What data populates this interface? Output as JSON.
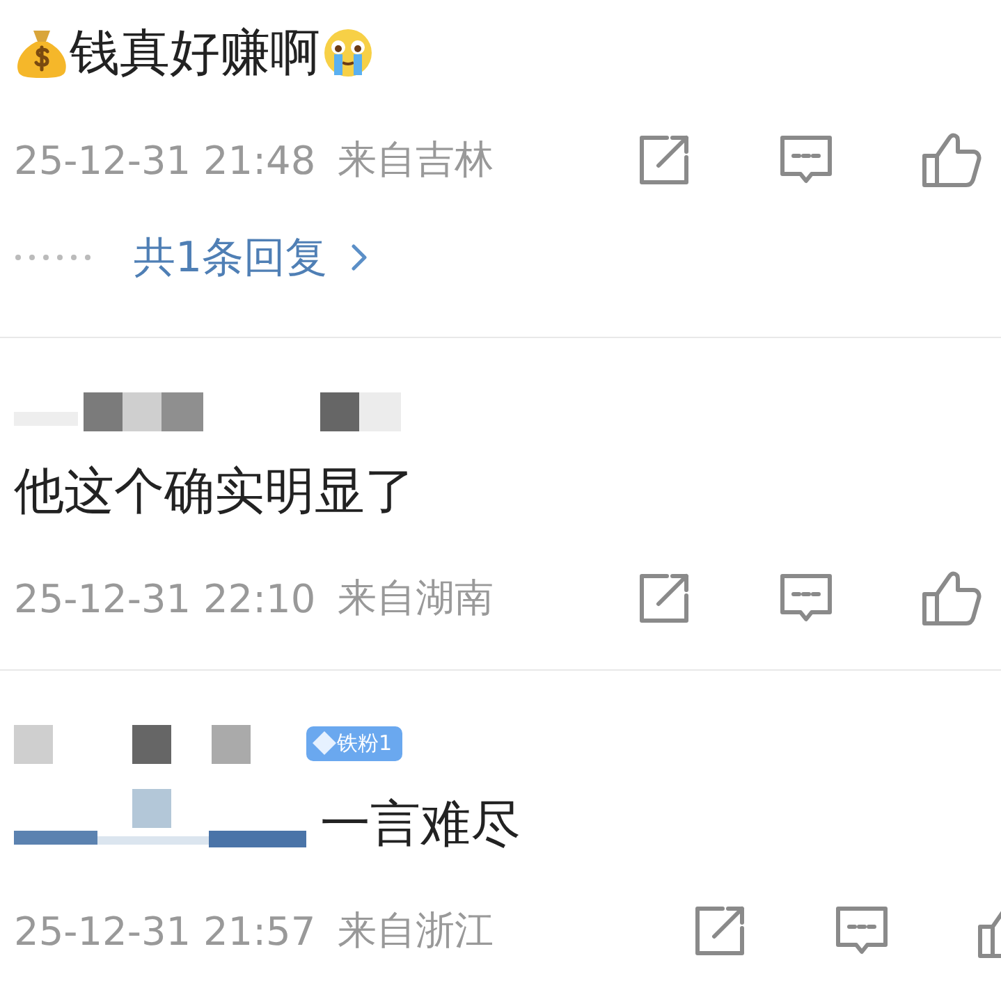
{
  "comments": [
    {
      "parts": [
        {
          "kind": "money-emoji"
        },
        {
          "kind": "text",
          "text": "钱真好赚啊"
        },
        {
          "kind": "crying-emoji"
        }
      ],
      "time": "25-12-31 21:48",
      "location": "来自吉林",
      "replies_link": "共1条回复"
    },
    {
      "author": {
        "kind": "redacted"
      },
      "parts": [
        {
          "kind": "text",
          "text": "他这个确实明显了"
        }
      ],
      "time": "25-12-31 22:10",
      "location": "来自湖南"
    },
    {
      "author": {
        "kind": "redacted",
        "badge": "铁粉1"
      },
      "parts": [
        {
          "kind": "mention"
        },
        {
          "kind": "text",
          "text": "一言难尽"
        }
      ],
      "time": "25-12-31 21:57",
      "location": "来自浙江"
    }
  ]
}
